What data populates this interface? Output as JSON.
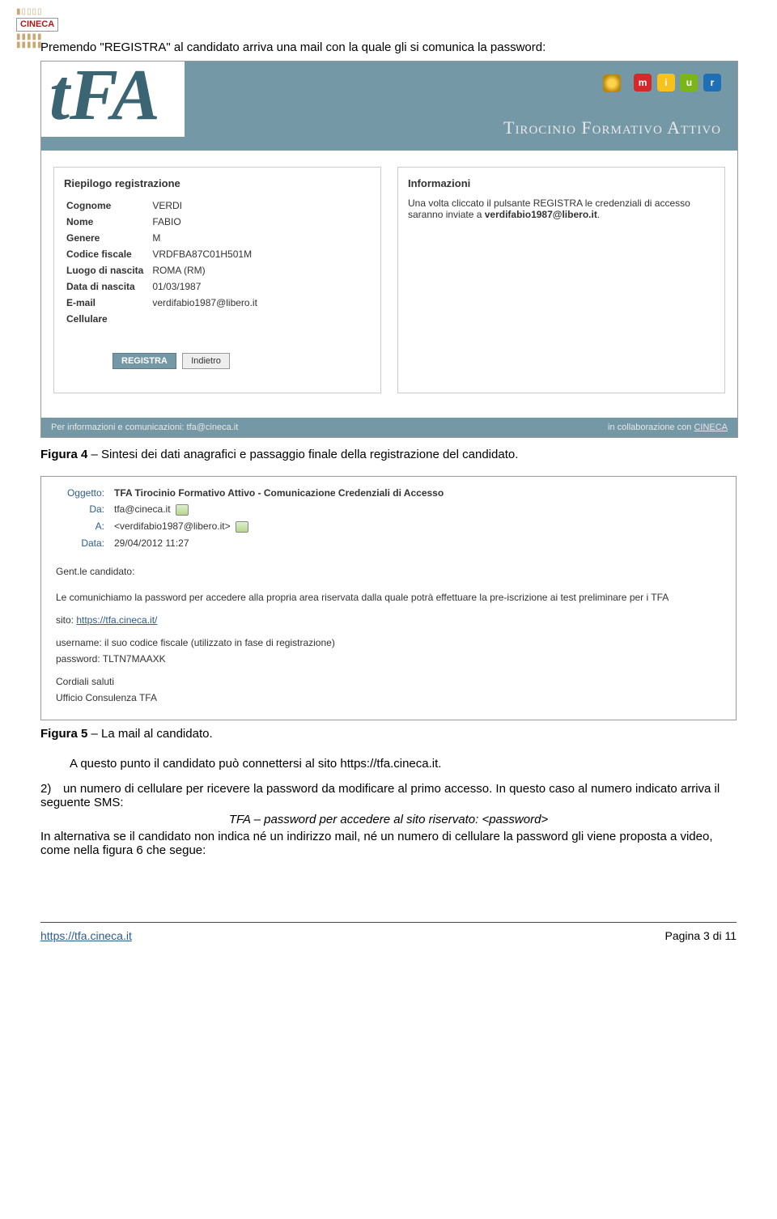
{
  "logo": {
    "brand": "CINECA"
  },
  "intro_text": "Premendo \"REGISTRA\" al candidato arriva una mail con la quale gli si comunica la password:",
  "screenshot1": {
    "header_title": "Tirocinio Formativo Attivo",
    "tfa_logo": "tFA",
    "miur_letters": [
      "m",
      "i",
      "u",
      "r"
    ],
    "left_panel": {
      "title": "Riepilogo registrazione",
      "rows": [
        {
          "label": "Cognome",
          "value": "VERDI"
        },
        {
          "label": "Nome",
          "value": "FABIO"
        },
        {
          "label": "Genere",
          "value": "M"
        },
        {
          "label": "Codice fiscale",
          "value": "VRDFBA87C01H501M"
        },
        {
          "label": "Luogo di nascita",
          "value": "ROMA (RM)"
        },
        {
          "label": "Data di nascita",
          "value": "01/03/1987"
        },
        {
          "label": "E-mail",
          "value": "verdifabio1987@libero.it"
        },
        {
          "label": "Cellulare",
          "value": ""
        }
      ],
      "btn_register": "REGISTRA",
      "btn_back": "Indietro"
    },
    "right_panel": {
      "title": "Informazioni",
      "text_before": "Una volta cliccato il pulsante REGISTRA le credenziali di accesso saranno inviate a ",
      "email": "verdifabio1987@libero.it",
      "text_after": "."
    },
    "footer_left": "Per informazioni e comunicazioni: tfa@cineca.it",
    "footer_right_pre": "in collaborazione con ",
    "footer_right_link": "CINECA"
  },
  "caption1_bold": "Figura 4",
  "caption1_rest": " – Sintesi dei dati anagrafici e passaggio finale della registrazione del candidato.",
  "mail": {
    "lbl_subject": "Oggetto:",
    "subject": "TFA Tirocinio Formativo Attivo - Comunicazione Credenziali di Accesso",
    "lbl_from": "Da:",
    "from": "tfa@cineca.it",
    "lbl_to": "A:",
    "to": "<verdifabio1987@libero.it>",
    "lbl_date": "Data:",
    "date": "29/04/2012 11:27",
    "greeting": "Gent.le candidato:",
    "body_intro": "Le comunichiamo la password per accedere alla propria area riservata dalla quale potrà effettuare la pre-iscrizione ai test preliminare per i TFA",
    "body_site_lbl": "sito: ",
    "body_site_link": "https://tfa.cineca.it/",
    "body_user": "username: il suo codice fiscale (utilizzato in fase di registrazione)",
    "body_pwd": "password: TLTN7MAAXK",
    "sign1": "Cordiali saluti",
    "sign2": "Ufficio Consulenza TFA"
  },
  "caption2_bold": "Figura 5",
  "caption2_rest": " – La mail al candidato.",
  "para_after_mail": "A questo punto il candidato può connettersi al sito https://tfa.cineca.it.",
  "list2_num": "2)",
  "list2_line1": "un numero di cellulare per ricevere la password da modificare al primo accesso. In questo caso al numero indicato arriva il seguente SMS:",
  "list2_sms": "TFA – password per accedere al sito riservato: <password>",
  "list2_line2": "In alternativa se il candidato non indica né un indirizzo mail, né un numero di cellulare la password gli viene proposta a video, come nella figura 6 che segue:",
  "footer_url": "https://tfa.cineca.it",
  "footer_page": "Pagina 3 di 11"
}
